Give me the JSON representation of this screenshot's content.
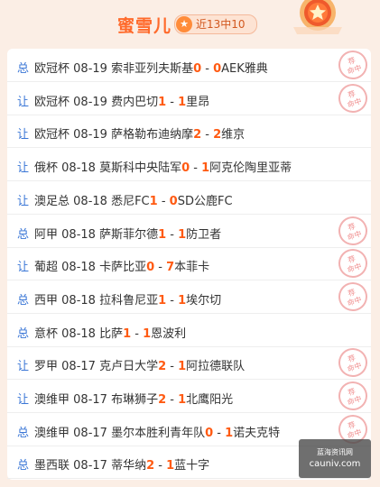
{
  "header": {
    "title": "蜜雪儿",
    "badge": "近13中10",
    "colors": {
      "accent": "#ff6a2b",
      "type": "#3a76d6",
      "score": "#ff5a12"
    }
  },
  "stamp_text": [
    "荐",
    "荐",
    "命中"
  ],
  "rows": [
    {
      "type": "总",
      "league": "欧冠杯",
      "date": "08-19",
      "home": "索非亚列夫斯基",
      "hs": "0",
      "as": "0",
      "away": "AEK雅典",
      "stamp": true
    },
    {
      "type": "让",
      "league": "欧冠杯",
      "date": "08-19",
      "home": "费内巴切",
      "hs": "1",
      "as": "1",
      "away": "里昂",
      "stamp": true
    },
    {
      "type": "让",
      "league": "欧冠杯",
      "date": "08-19",
      "home": "萨格勒布迪纳摩",
      "hs": "2",
      "as": "2",
      "away": "维京",
      "stamp": false
    },
    {
      "type": "让",
      "league": "俄杯",
      "date": "08-18",
      "home": "莫斯科中央陆军",
      "hs": "0",
      "as": "1",
      "away": "阿克伦陶里亚蒂",
      "stamp": false
    },
    {
      "type": "让",
      "league": "澳足总",
      "date": "08-18",
      "home": "悉尼FC",
      "hs": "1",
      "as": "0",
      "away": "SD公鹿FC",
      "stamp": false
    },
    {
      "type": "总",
      "league": "阿甲",
      "date": "08-18",
      "home": "萨斯菲尔德",
      "hs": "1",
      "as": "1",
      "away": "防卫者",
      "stamp": true
    },
    {
      "type": "让",
      "league": "葡超",
      "date": "08-18",
      "home": "卡萨比亚",
      "hs": "0",
      "as": "7",
      "away": "本菲卡",
      "stamp": true
    },
    {
      "type": "总",
      "league": "西甲",
      "date": "08-18",
      "home": "拉科鲁尼亚",
      "hs": "1",
      "as": "1",
      "away": "埃尔切",
      "stamp": true
    },
    {
      "type": "总",
      "league": "意杯",
      "date": "08-18",
      "home": "比萨",
      "hs": "1",
      "as": "1",
      "away": "恩波利",
      "stamp": false
    },
    {
      "type": "让",
      "league": "罗甲",
      "date": "08-17",
      "home": "克卢日大学",
      "hs": "2",
      "as": "1",
      "away": "阿拉德联队",
      "stamp": true
    },
    {
      "type": "让",
      "league": "澳维甲",
      "date": "08-17",
      "home": "布琳狮子",
      "hs": "2",
      "as": "1",
      "away": "北鹰阳光",
      "stamp": true
    },
    {
      "type": "总",
      "league": "澳维甲",
      "date": "08-17",
      "home": "墨尔本胜利青年队",
      "hs": "0",
      "as": "1",
      "away": "诺夫克特",
      "stamp": true
    },
    {
      "type": "总",
      "league": "墨西联",
      "date": "08-17",
      "home": "蒂华纳",
      "hs": "2",
      "as": "1",
      "away": "蓝十字",
      "stamp": false
    }
  ],
  "watermark": {
    "line1": "蓝海资讯网",
    "line2": "cauniv.com"
  }
}
